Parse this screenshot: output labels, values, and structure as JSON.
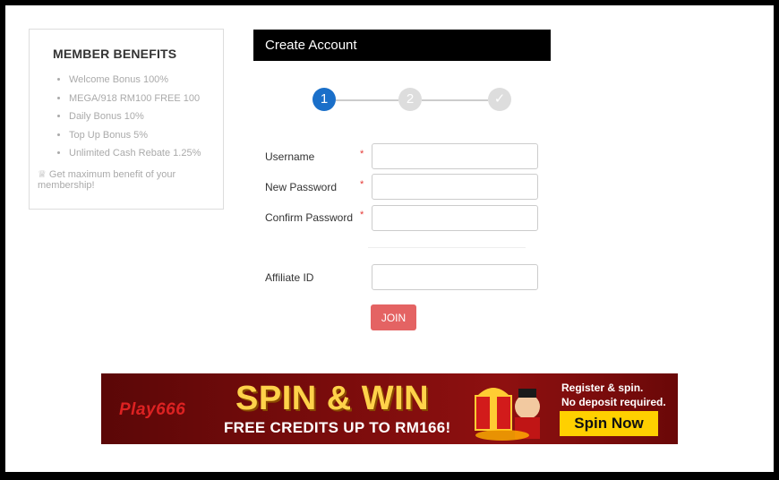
{
  "benefits": {
    "title": "MEMBER BENEFITS",
    "items": [
      "Welcome Bonus 100%",
      "MEGA/918 RM100 FREE 100",
      "Daily Bonus 10%",
      "Top Up Bonus 5%",
      "Unlimited Cash Rebate 1.25%"
    ],
    "note": "♕ Get maximum benefit of your membership!"
  },
  "form": {
    "header": "Create Account",
    "steps": [
      "1",
      "2",
      "✓"
    ],
    "fields": {
      "username_label": "Username",
      "new_password_label": "New Password",
      "confirm_password_label": "Confirm Password",
      "affiliate_label": "Affiliate ID",
      "required_mark": "*"
    },
    "join_label": "JOIN"
  },
  "banner": {
    "logo": "Play666",
    "headline": "SPIN & WIN",
    "subline": "FREE CREDITS UP TO RM166!",
    "tagline1": "Register & spin.",
    "tagline2": "No deposit required.",
    "cta": "Spin Now"
  },
  "colors": {
    "step_active": "#1a6fc9",
    "step_inactive": "#dddddd",
    "join_button": "#e46363",
    "header_bg": "#000000",
    "banner_bg": "#7a0c0c",
    "banner_headline": "#ffd24a",
    "banner_cta": "#ffd000"
  }
}
